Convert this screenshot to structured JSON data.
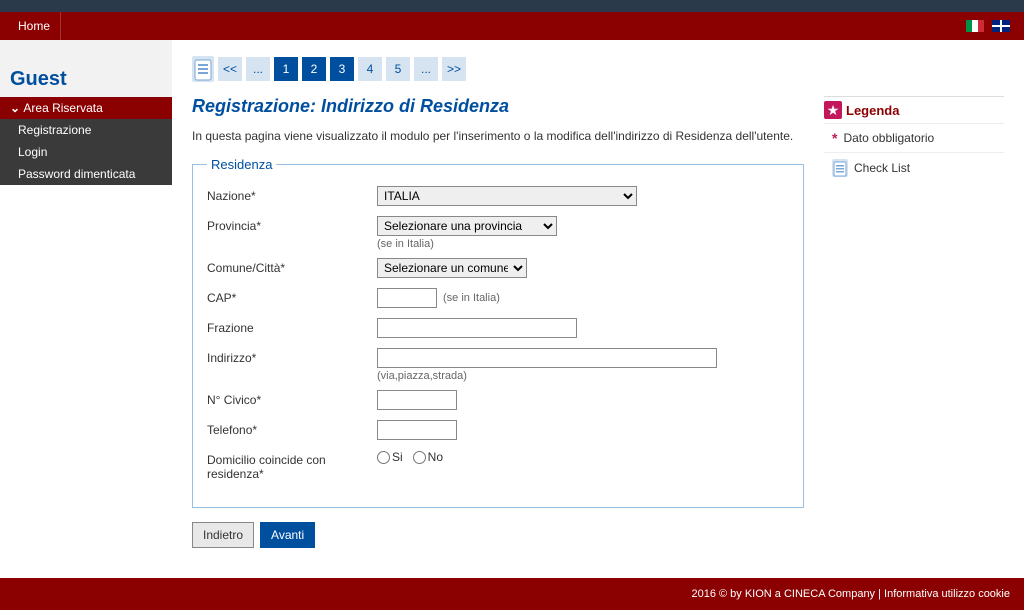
{
  "menu": {
    "home": "Home"
  },
  "sidebar": {
    "guest": "Guest",
    "area_riservata": "Area Riservata",
    "items": [
      {
        "label": "Registrazione"
      },
      {
        "label": "Login"
      },
      {
        "label": "Password dimenticata"
      }
    ]
  },
  "stepper": {
    "first": "<<",
    "prev": "...",
    "p1": "1",
    "p2": "2",
    "p3": "3",
    "p4": "4",
    "p5": "5",
    "next": "...",
    "last": ">>"
  },
  "page": {
    "title": "Registrazione: Indirizzo di Residenza",
    "desc": "In questa pagina viene visualizzato il modulo per l'inserimento o la modifica dell'indirizzo di Residenza dell'utente."
  },
  "fieldset_legend": "Residenza",
  "form": {
    "nazione_label": "Nazione*",
    "nazione_value": "ITALIA",
    "provincia_label": "Provincia*",
    "provincia_value": "Selezionare una provincia",
    "provincia_hint": "(se in Italia)",
    "comune_label": "Comune/Città*",
    "comune_value": "Selezionare un comune",
    "cap_label": "CAP*",
    "cap_value": "",
    "cap_hint": "(se in Italia)",
    "frazione_label": "Frazione",
    "frazione_value": "",
    "indirizzo_label": "Indirizzo*",
    "indirizzo_value": "",
    "indirizzo_hint": "(via,piazza,strada)",
    "civico_label": "N° Civico*",
    "civico_value": "",
    "telefono_label": "Telefono*",
    "telefono_value": "",
    "domicilio_label": "Domicilio coincide con residenza*",
    "domicilio_si": "Si",
    "domicilio_no": "No"
  },
  "buttons": {
    "back": "Indietro",
    "next": "Avanti"
  },
  "legend": {
    "title": "Legenda",
    "dato": "Dato obbligatorio",
    "checklist": "Check List"
  },
  "footer": {
    "copyright": "2016 © by KION a CINECA Company",
    "sep": " | ",
    "cookie": "Informativa utilizzo cookie"
  }
}
